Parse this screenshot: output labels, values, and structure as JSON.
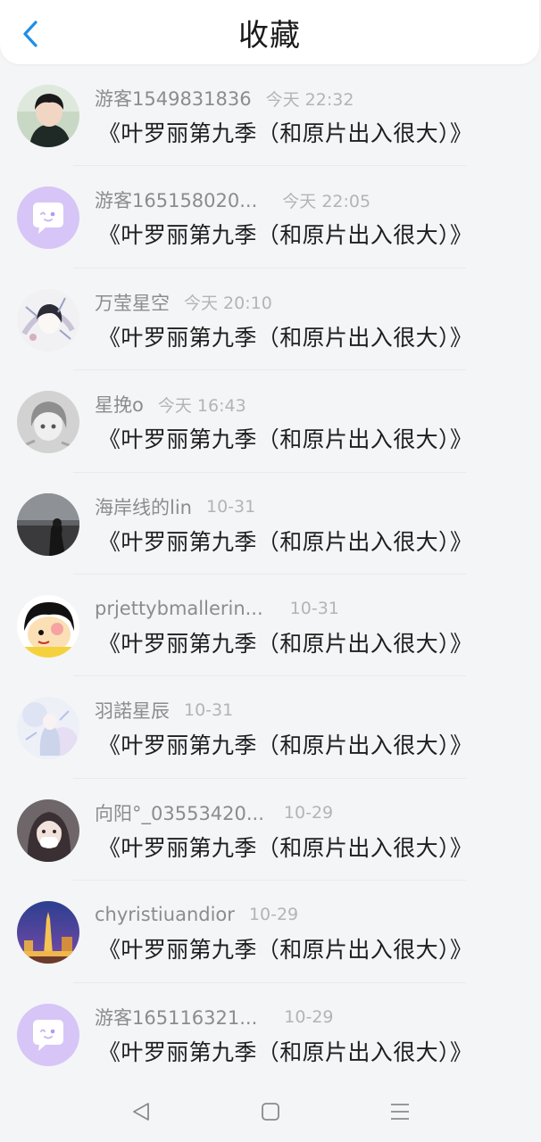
{
  "header": {
    "title": "收藏",
    "accent_color": "#1e8fe8"
  },
  "items": [
    {
      "name": "游客1549831836",
      "time": "今天 22:32",
      "message": "《叶罗丽第九季（和原片出入很大）》",
      "avatar": "boy-photo"
    },
    {
      "name": "游客165158020...",
      "time": "今天 22:05",
      "message": "《叶罗丽第九季（和原片出入很大）》",
      "avatar": "default-chat-bubble"
    },
    {
      "name": "万莹星空",
      "time": "今天 20:10",
      "message": "《叶罗丽第九季（和原片出入很大）》",
      "avatar": "anime-girl-sketch"
    },
    {
      "name": "星挽o",
      "time": "今天 16:43",
      "message": "《叶罗丽第九季（和原片出入很大）》",
      "avatar": "anime-girl-gray"
    },
    {
      "name": "海岸线的lin",
      "time": "10-31",
      "message": "《叶罗丽第九季（和原片出入很大）》",
      "avatar": "seaside-photo"
    },
    {
      "name": "prjettybmallerin...",
      "time": "10-31",
      "message": "《叶罗丽第九季（和原片出入很大）》",
      "avatar": "cartoon-face"
    },
    {
      "name": "羽諾星辰",
      "time": "10-31",
      "message": "《叶罗丽第九季（和原片出入很大）》",
      "avatar": "pastel-anime"
    },
    {
      "name": "向阳°_03553420...",
      "time": "10-29",
      "message": "《叶罗丽第九季（和原片出入很大）》",
      "avatar": "masked-girl"
    },
    {
      "name": "chyristiuandior",
      "time": "10-29",
      "message": "《叶罗丽第九季（和原片出入很大）》",
      "avatar": "city-night"
    },
    {
      "name": "游客165116321...",
      "time": "10-29",
      "message": "《叶罗丽第九季（和原片出入很大）》",
      "avatar": "default-chat-bubble"
    }
  ],
  "navbar": {
    "icons": [
      "back-triangle-icon",
      "home-square-icon",
      "menu-lines-icon"
    ]
  }
}
